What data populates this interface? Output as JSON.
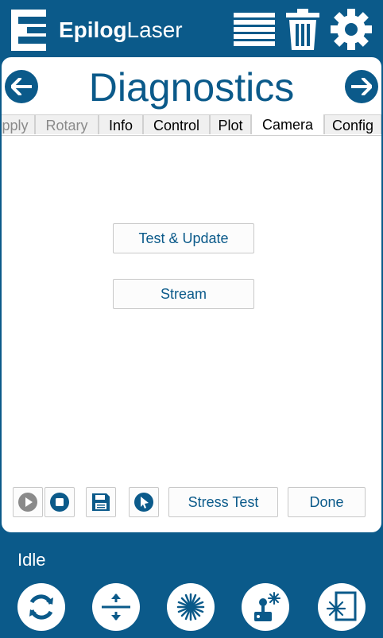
{
  "header": {
    "brand_bold": "Epilog",
    "brand_light": "Laser",
    "icons": [
      "list-icon",
      "trash-icon",
      "gear-icon"
    ]
  },
  "page": {
    "title": "Diagnostics",
    "back_icon": "arrow-left-icon",
    "forward_icon": "arrow-right-icon"
  },
  "tabs": [
    {
      "label": "pply"
    },
    {
      "label": "Rotary"
    },
    {
      "label": "Info"
    },
    {
      "label": "Control"
    },
    {
      "label": "Plot"
    },
    {
      "label": "Camera",
      "active": true
    },
    {
      "label": "Config"
    }
  ],
  "camera": {
    "test_update_label": "Test & Update",
    "stream_label": "Stream"
  },
  "toolbar": {
    "icons": [
      "play-icon",
      "stop-icon",
      "save-icon",
      "cursor-icon"
    ],
    "stress_test_label": "Stress Test",
    "done_label": "Done"
  },
  "footer": {
    "status": "Idle",
    "icons": [
      "refresh-icon",
      "focus-icon",
      "laser-icon",
      "joystick-icon",
      "laser-frame-icon"
    ]
  },
  "colors": {
    "brand": "#0b5a8a",
    "panel": "#ffffff"
  }
}
